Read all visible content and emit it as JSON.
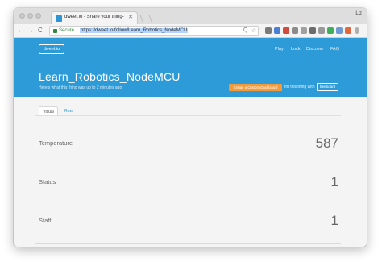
{
  "browser": {
    "tab_title": "dweet.io - Share your thing- li",
    "tab_close": "✕",
    "profile": "Liz",
    "nav": {
      "back": "←",
      "forward": "→",
      "reload": "C"
    },
    "secure_label": "Secure",
    "url": "https://dweet.io/follow/Learn_Robotics_NodeMCU",
    "omnibox_icons": [
      "Q",
      "☆"
    ]
  },
  "site": {
    "logo": "dweet.io",
    "nav": [
      "Play",
      "Lock",
      "Discover",
      "FAQ"
    ],
    "thing_name": "Learn_Robotics_NodeMCU",
    "subtitle": "Here's what this thing was up to 2 minutes ago",
    "create_button": "Create a Custom Dashboard",
    "create_suffix": "for this thing with",
    "freeboard_button": "freeboard",
    "view_tabs": [
      "Visual",
      "Raw"
    ]
  },
  "readings": [
    {
      "label": "Temperature",
      "value": "587"
    },
    {
      "label": "Status",
      "value": "1"
    },
    {
      "label": "Staff",
      "value": "1"
    }
  ],
  "colors": {
    "brand_blue": "#2d9bd8",
    "cta_orange": "#f39b3a",
    "secure_green": "#2e8b3a"
  },
  "icons": {
    "browser_tab_favicon": "dweet-favicon-icon",
    "omnibox": [
      "search-icon",
      "star-icon"
    ],
    "extensions": [
      "extension-icon"
    ]
  }
}
